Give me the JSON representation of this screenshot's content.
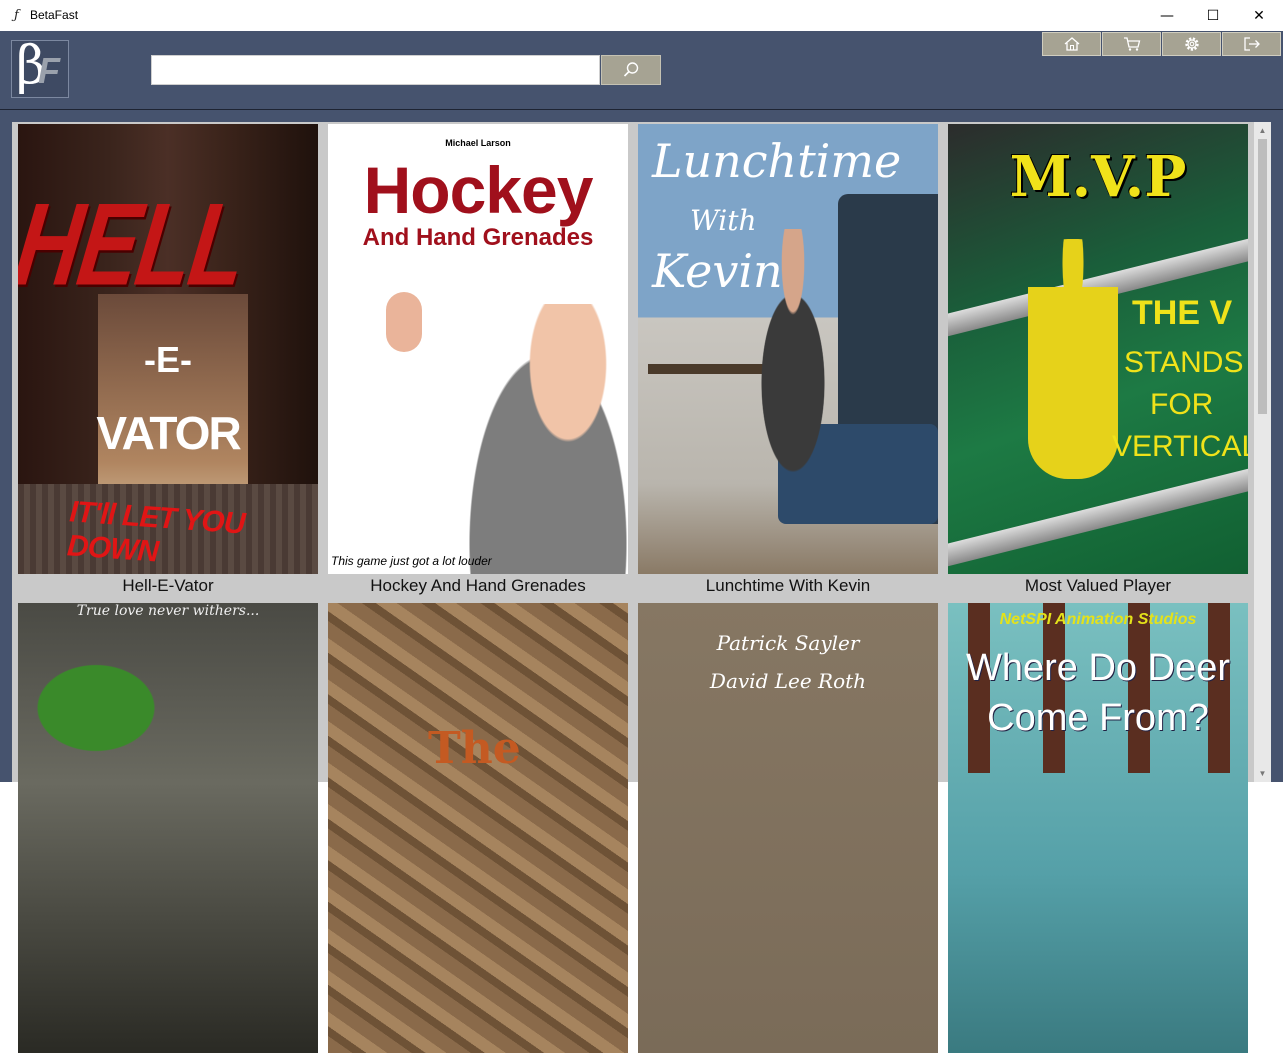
{
  "window": {
    "icon_glyph": "ƒ",
    "title": "BetaFast",
    "minimize_glyph": "—",
    "maximize_glyph": "☐",
    "close_glyph": "✕"
  },
  "header": {
    "logo": {
      "b": "β",
      "f": "F"
    },
    "search": {
      "value": "",
      "placeholder": ""
    },
    "nav": [
      {
        "name": "home",
        "icon": "home-icon"
      },
      {
        "name": "cart",
        "icon": "cart-icon"
      },
      {
        "name": "settings",
        "icon": "gear-icon"
      },
      {
        "name": "logout",
        "icon": "logout-icon"
      }
    ]
  },
  "movies": [
    {
      "caption": "Hell-E-Vator",
      "poster": {
        "big": "HELL",
        "e": "-E-",
        "vator": "VATOR",
        "tag": "IT'll LET YOU DOWN"
      }
    },
    {
      "caption": "Hockey And Hand Grenades",
      "poster": {
        "author": "Michael Larson",
        "title": "Hockey",
        "sub": "And Hand Grenades",
        "line": "This game just got a lot louder"
      }
    },
    {
      "caption": "Lunchtime With Kevin",
      "poster": {
        "t1": "Lunchtime",
        "t2": "With",
        "t3": "Kevin"
      }
    },
    {
      "caption": "Most Valued Player",
      "poster": {
        "title": "M.V.P",
        "l1": "THE V",
        "l2": "STANDS",
        "l3": "FOR",
        "l4": "VERTICAL"
      }
    },
    {
      "caption": "",
      "poster": {
        "tag": "True love never withers..."
      }
    },
    {
      "caption": "",
      "poster": {
        "the": "The"
      }
    },
    {
      "caption": "",
      "poster": {
        "n1": "Patrick Sayler",
        "n2": "David Lee Roth"
      }
    },
    {
      "caption": "",
      "poster": {
        "studio": "NetSPI Animation Studios",
        "t": "Where Do Deer Come From?"
      }
    }
  ],
  "scrollbar": {
    "up_glyph": "▲",
    "down_glyph": "▼"
  },
  "colors": {
    "header_bg": "#46536e",
    "accent_button": "#a6a393",
    "panel_bg": "#c9c9c9"
  }
}
